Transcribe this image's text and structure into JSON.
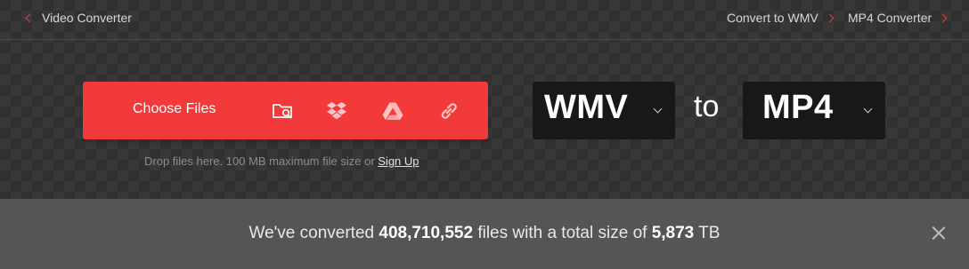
{
  "nav": {
    "back_label": "Video Converter",
    "links": [
      {
        "label": "Convert to WMV"
      },
      {
        "label": "MP4 Converter"
      }
    ]
  },
  "upload": {
    "choose_label": "Choose Files",
    "sources": [
      "folder-search-icon",
      "dropbox-icon",
      "google-drive-icon",
      "link-icon"
    ],
    "hint_text": "Drop files here. 100 MB maximum file size or ",
    "signup_label": "Sign Up"
  },
  "converter": {
    "from_format": "WMV",
    "to_word": "to",
    "to_format": "MP4"
  },
  "stats": {
    "prefix": "We've converted ",
    "files_count": "408,710,552",
    "middle": " files with a total size of ",
    "total_size": "5,873",
    "unit": " TB"
  },
  "colors": {
    "accent": "#f33a3a",
    "background": "#313131",
    "banner": "#555555",
    "selector_bg": "#181818"
  }
}
